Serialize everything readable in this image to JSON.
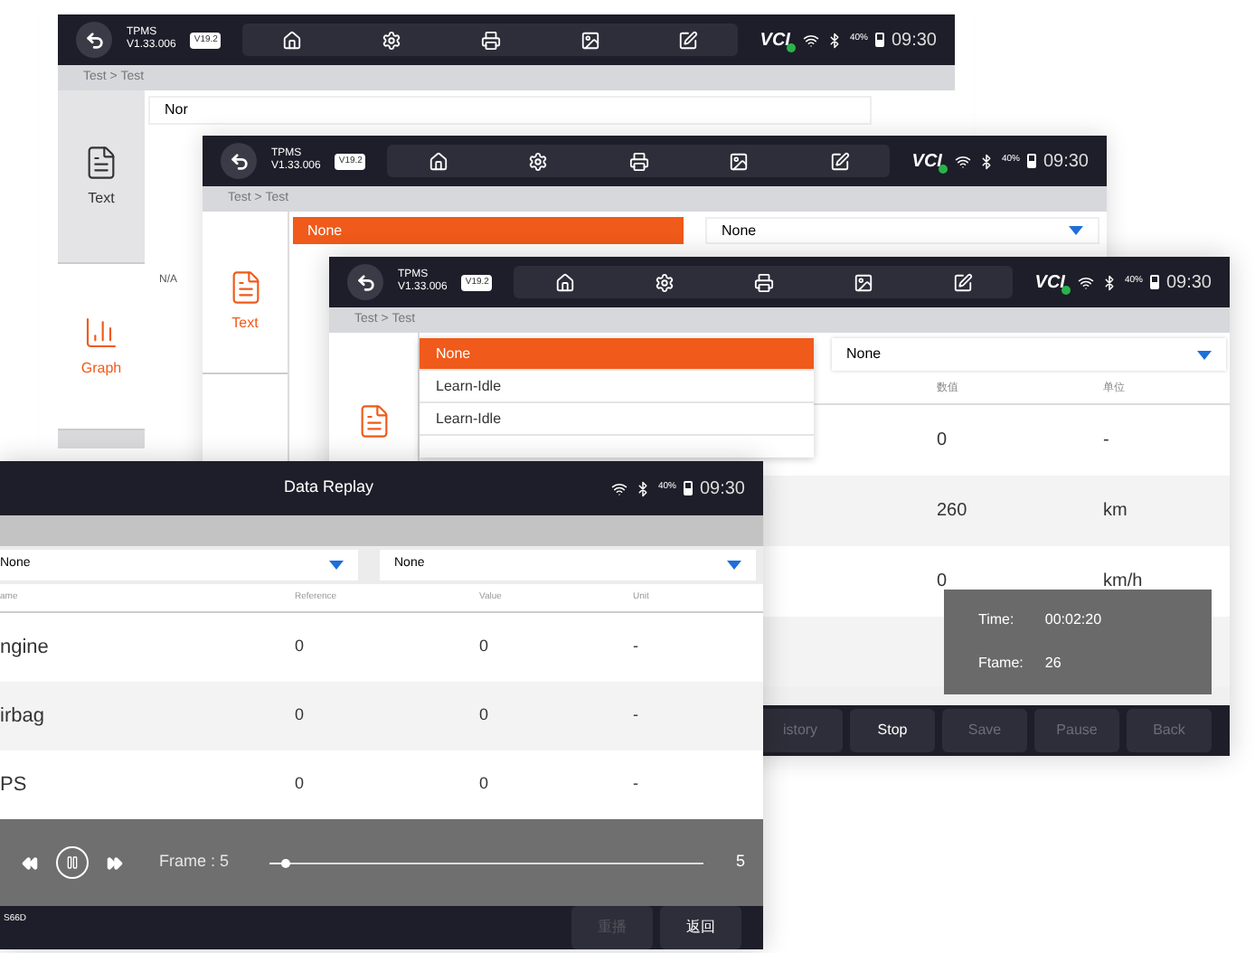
{
  "screens": [
    {
      "status": {
        "app": "TPMS",
        "version": "V1.33.006",
        "badge": "V19.2",
        "logo": "VCI",
        "battery": "40%",
        "time": "09:30"
      },
      "breadcrumb": "Test > Test",
      "sidebar": [
        {
          "kind": "text",
          "label": "Text",
          "selected": false
        },
        {
          "kind": "graph",
          "label": "Graph",
          "selected": true
        }
      ],
      "dropdown": {
        "value": "Nor"
      },
      "cell": "N/A"
    },
    {
      "status": {
        "app": "TPMS",
        "version": "V1.33.006",
        "badge": "V19.2",
        "logo": "VCI",
        "battery": "40%",
        "time": "09:30"
      },
      "breadcrumb": "Test > Test",
      "sidebar": [
        {
          "kind": "text",
          "label": "Text",
          "selected": true
        }
      ],
      "dropdown": {
        "value": "None",
        "open": true
      },
      "dropdown_right": {
        "value": "None"
      }
    },
    {
      "status": {
        "app": "TPMS",
        "version": "V1.33.006",
        "badge": "V19.2",
        "logo": "VCI",
        "battery": "40%",
        "time": "09:30"
      },
      "breadcrumb": "Test > Test",
      "sidebar": [
        {
          "kind": "text",
          "selected": true
        }
      ],
      "dropdown": {
        "open": true,
        "options": [
          {
            "label": "None",
            "selected": true
          },
          {
            "label": "Learn-Idle",
            "selected": false
          },
          {
            "label": "Learn-Idle",
            "selected": false
          }
        ]
      },
      "dropdown_right": {
        "value": "None"
      },
      "table": {
        "columns": [
          "数值",
          "单位"
        ],
        "rows": [
          [
            "0",
            "-"
          ],
          [
            "260",
            "km"
          ],
          [
            "0",
            "km/h"
          ]
        ]
      },
      "replay_info": {
        "time_label": "Time:",
        "time": "00:02:20",
        "frame_label": "Ftame:",
        "frame": "26"
      },
      "buttons": [
        {
          "label": "istory",
          "disabled": true
        },
        {
          "label": "Stop",
          "disabled": false
        },
        {
          "label": "Save",
          "disabled": true
        },
        {
          "label": "Pause",
          "disabled": true
        },
        {
          "label": "Back",
          "disabled": true
        }
      ]
    },
    {
      "title": "Data Replay",
      "status": {
        "battery": "40%",
        "time": "09:30"
      },
      "dropdowns": [
        "None",
        "None"
      ],
      "table": {
        "columns": [
          "ame",
          "Reference",
          "Value",
          "Unit"
        ],
        "rows": [
          [
            "ngine",
            "0",
            "0",
            "-"
          ],
          [
            "irbag",
            "0",
            "0",
            "-"
          ],
          [
            "PS",
            "0",
            "0",
            "-"
          ]
        ]
      },
      "player": {
        "frame": "Frame : 5",
        "level": 0.04,
        "max": "5"
      },
      "footer": {
        "vehicle": "S66D",
        "buttons": [
          {
            "label": "重播",
            "disabled": true
          },
          {
            "label": "返回",
            "disabled": false
          }
        ]
      }
    }
  ]
}
